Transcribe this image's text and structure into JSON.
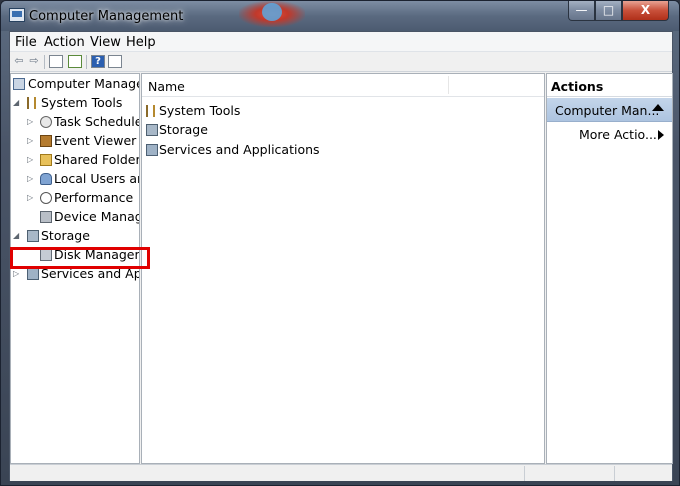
{
  "window": {
    "title": "Computer Management"
  },
  "title_buttons": {
    "minimize": "—",
    "maximize": "□",
    "close": "X"
  },
  "menu": {
    "file": "File",
    "action": "Action",
    "view": "View",
    "help": "Help"
  },
  "toolbar": {
    "back": "⇦",
    "forward": "⇨",
    "help": "?"
  },
  "tree": {
    "root": "Computer Management (Local)",
    "system_tools": "System Tools",
    "task_scheduler": "Task Scheduler",
    "event_viewer": "Event Viewer",
    "shared_folders": "Shared Folders",
    "local_users": "Local Users and Groups",
    "performance": "Performance",
    "device_manager": "Device Manager",
    "storage": "Storage",
    "disk_management": "Disk Management",
    "services_apps": "Services and Applications"
  },
  "main": {
    "column_header": "Name",
    "rows": [
      "System Tools",
      "Storage",
      "Services and Applications"
    ]
  },
  "actions": {
    "header": "Actions",
    "primary": "Computer Man...",
    "more": "More Actio..."
  },
  "colors": {
    "highlight_border": "#e00000",
    "actions_selected": "#b9cde6"
  }
}
